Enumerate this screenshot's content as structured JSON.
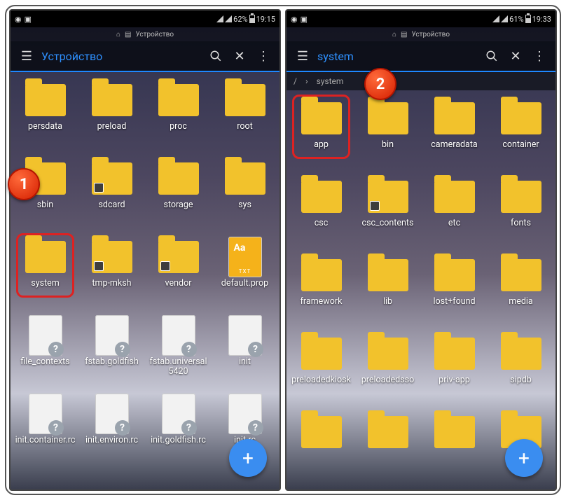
{
  "callouts": {
    "one": "1",
    "two": "2"
  },
  "left": {
    "status": {
      "battery": "62%",
      "time": "19:15"
    },
    "mini_crumb": "Устройство",
    "title": "Устройство",
    "items": [
      {
        "type": "folder",
        "label": "persdata"
      },
      {
        "type": "folder",
        "label": "preload"
      },
      {
        "type": "folder",
        "label": "proc"
      },
      {
        "type": "folder",
        "label": "root"
      },
      {
        "type": "folder-link",
        "label": "sbin"
      },
      {
        "type": "folder-link",
        "label": "sdcard"
      },
      {
        "type": "folder",
        "label": "storage"
      },
      {
        "type": "folder",
        "label": "sys"
      },
      {
        "type": "folder",
        "label": "system",
        "hl": true
      },
      {
        "type": "folder-link",
        "label": "tmp-mksh"
      },
      {
        "type": "folder-link",
        "label": "vendor"
      },
      {
        "type": "txt",
        "label": "default.prop"
      },
      {
        "type": "fq",
        "label": "file_contexts"
      },
      {
        "type": "fq",
        "label": "fstab.goldfish"
      },
      {
        "type": "fq",
        "label": "fstab.universal5420"
      },
      {
        "type": "fq",
        "label": "init"
      },
      {
        "type": "fq",
        "label": "init.container.rc"
      },
      {
        "type": "fq",
        "label": "init.environ.rc"
      },
      {
        "type": "fq",
        "label": "init.goldfish.rc"
      },
      {
        "type": "fq",
        "label": "init.rc"
      }
    ]
  },
  "right": {
    "status": {
      "battery": "61%",
      "time": "19:33"
    },
    "mini_crumb": "Устройство",
    "title": "system",
    "crumb": [
      "/",
      "system"
    ],
    "items": [
      {
        "type": "folder",
        "label": "app",
        "hl": true
      },
      {
        "type": "folder",
        "label": "bin"
      },
      {
        "type": "folder",
        "label": "cameradata"
      },
      {
        "type": "folder",
        "label": "container"
      },
      {
        "type": "folder",
        "label": "csc"
      },
      {
        "type": "folder-link",
        "label": "csc_contents"
      },
      {
        "type": "folder",
        "label": "etc"
      },
      {
        "type": "folder",
        "label": "fonts"
      },
      {
        "type": "folder",
        "label": "framework"
      },
      {
        "type": "folder",
        "label": "lib"
      },
      {
        "type": "folder",
        "label": "lost+found"
      },
      {
        "type": "folder",
        "label": "media"
      },
      {
        "type": "folder",
        "label": "preloadedkiosk"
      },
      {
        "type": "folder",
        "label": "preloadedsso"
      },
      {
        "type": "folder",
        "label": "priv-app"
      },
      {
        "type": "folder",
        "label": "sipdb"
      },
      {
        "type": "folder",
        "label": ""
      },
      {
        "type": "folder",
        "label": ""
      },
      {
        "type": "folder",
        "label": ""
      },
      {
        "type": "folder",
        "label": ""
      }
    ]
  }
}
